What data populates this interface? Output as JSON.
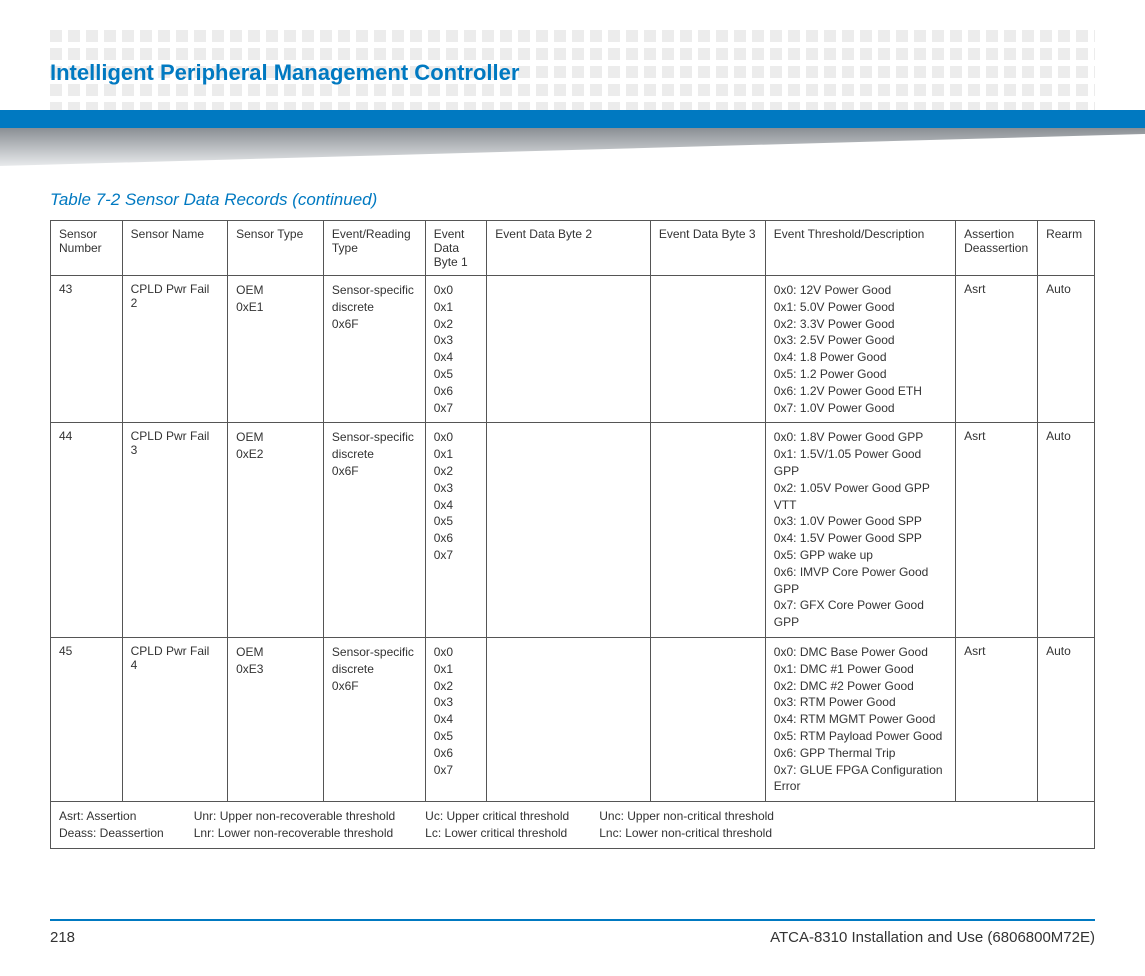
{
  "header": {
    "title": "Intelligent Peripheral Management Controller"
  },
  "table": {
    "caption": "Table 7-2 Sensor Data Records (continued)",
    "columns": [
      "Sensor Number",
      "Sensor Name",
      "Sensor Type",
      "Event/Reading Type",
      "Event Data Byte 1",
      "Event Data Byte 2",
      "Event Data Byte 3",
      "Event Threshold/Description",
      "Assertion Deassertion",
      "Rearm"
    ],
    "rows": [
      {
        "sensor_number": "43",
        "sensor_name": "CPLD Pwr Fail 2",
        "sensor_type": [
          "OEM",
          "0xE1"
        ],
        "event_reading_type": [
          "Sensor-specific",
          "discrete",
          "0x6F"
        ],
        "event_data_byte1": [
          "0x0",
          "0x1",
          "0x2",
          "0x3",
          "0x4",
          "0x5",
          "0x6",
          "0x7"
        ],
        "event_data_byte2": "",
        "event_data_byte3": "",
        "threshold_description": [
          "0x0: 12V Power Good",
          "0x1: 5.0V Power Good",
          "0x2: 3.3V Power Good",
          "0x3: 2.5V Power Good",
          "0x4: 1.8 Power Good",
          "0x5: 1.2 Power Good",
          "0x6: 1.2V Power Good ETH",
          "0x7: 1.0V Power Good"
        ],
        "assertion_deassertion": "Asrt",
        "rearm": "Auto"
      },
      {
        "sensor_number": "44",
        "sensor_name": "CPLD Pwr Fail 3",
        "sensor_type": [
          "OEM",
          "0xE2"
        ],
        "event_reading_type": [
          "Sensor-specific",
          "discrete",
          "0x6F"
        ],
        "event_data_byte1": [
          "0x0",
          "0x1",
          "0x2",
          "0x3",
          "0x4",
          "0x5",
          "0x6",
          "0x7"
        ],
        "event_data_byte2": "",
        "event_data_byte3": "",
        "threshold_description": [
          "0x0: 1.8V Power Good GPP",
          "0x1: 1.5V/1.05 Power Good GPP",
          "0x2: 1.05V Power Good GPP VTT",
          "0x3: 1.0V Power Good SPP",
          "0x4: 1.5V Power Good SPP",
          "0x5: GPP wake up",
          "0x6: IMVP Core Power Good GPP",
          "0x7: GFX Core Power Good GPP"
        ],
        "assertion_deassertion": "Asrt",
        "rearm": "Auto"
      },
      {
        "sensor_number": "45",
        "sensor_name": "CPLD Pwr Fail 4",
        "sensor_type": [
          "OEM",
          "0xE3"
        ],
        "event_reading_type": [
          "Sensor-specific",
          "discrete",
          "0x6F"
        ],
        "event_data_byte1": [
          "0x0",
          "0x1",
          "0x2",
          "0x3",
          "0x4",
          "0x5",
          "0x6",
          "0x7"
        ],
        "event_data_byte2": "",
        "event_data_byte3": "",
        "threshold_description": [
          "0x0: DMC Base Power Good",
          "0x1: DMC #1 Power Good",
          "0x2: DMC #2 Power Good",
          "0x3: RTM Power Good",
          "0x4: RTM MGMT Power Good",
          "0x5: RTM Payload Power Good",
          "0x6: GPP Thermal Trip",
          "0x7: GLUE FPGA Configuration Error"
        ],
        "assertion_deassertion": "Asrt",
        "rearm": "Auto"
      }
    ],
    "legend": {
      "col1": [
        "Asrt: Assertion",
        "Deass: Deassertion"
      ],
      "col2": [
        "Unr: Upper non-recoverable threshold",
        "Lnr: Lower non-recoverable threshold"
      ],
      "col3": [
        "Uc: Upper critical threshold",
        "Lc: Lower critical threshold"
      ],
      "col4": [
        "Unc: Upper non-critical threshold",
        "Lnc: Lower non-critical threshold"
      ]
    }
  },
  "footer": {
    "page_number": "218",
    "doc_id": "ATCA-8310 Installation and Use (6806800M72E)"
  }
}
